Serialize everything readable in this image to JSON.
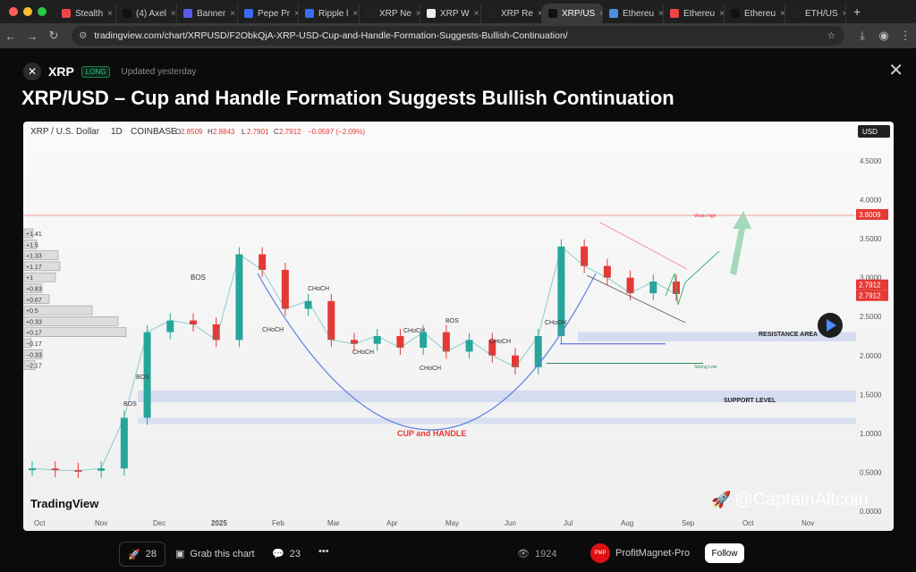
{
  "browser": {
    "tabs": [
      {
        "label": "Stealth",
        "color": "#e44"
      },
      {
        "label": "(4) Axel",
        "color": "#111"
      },
      {
        "label": "Banner",
        "color": "#5a5af0"
      },
      {
        "label": "Pepe Pr",
        "color": "#3b6cf0"
      },
      {
        "label": "Ripple l",
        "color": "#3b6cf0"
      },
      {
        "label": "XRP Ne",
        "color": "#222"
      },
      {
        "label": "XRP W",
        "color": "#eee"
      },
      {
        "label": "XRP Re",
        "color": "#222"
      },
      {
        "label": "XRP/US",
        "color": "#111",
        "active": true
      },
      {
        "label": "Ethereu",
        "color": "#4a90e2"
      },
      {
        "label": "Ethereu",
        "color": "#e44"
      },
      {
        "label": "Ethereu",
        "color": "#111"
      },
      {
        "label": "ETH/US",
        "color": "#222"
      }
    ],
    "new_tab": "+",
    "url": "tradingview.com/chart/XRPUSD/F2ObkQjA-XRP-USD-Cup-and-Handle-Formation-Suggests-Bullish-Continuation/"
  },
  "header": {
    "symbol": "XRP",
    "badge": "LONG",
    "updated": "Updated yesterday",
    "title": "XRP/USD – Cup and Handle Formation Suggests Bullish Continuation"
  },
  "chart_header": {
    "instrument": "XRP / U.S. Dollar",
    "interval": "1D",
    "exchange": "COINBASE",
    "o_label": "O",
    "o": "2.8509",
    "h_label": "H",
    "h": "2.8843",
    "l_label": "L",
    "l": "2.7901",
    "c_label": "C",
    "c": "2.7912",
    "change": "−0.0597 (−2.09%)",
    "currency": "USD"
  },
  "chart_data": {
    "type": "line",
    "title": "XRP/USD – Cup and Handle Formation Suggests Bullish Continuation",
    "x": [
      "Oct",
      "Nov",
      "Dec",
      "2025",
      "Feb",
      "Mar",
      "Apr",
      "May",
      "Jun",
      "Jul",
      "Aug",
      "Sep",
      "Oct",
      "Nov"
    ],
    "y_ticks": [
      "4.5000",
      "4.0000",
      "3.5000",
      "3.0000",
      "2.5000",
      "2.0000",
      "1.5000",
      "1.0000",
      "0.5000",
      "0.0000"
    ],
    "ylim": [
      0,
      4.5
    ],
    "series": [
      {
        "values": [
          0.55,
          0.53,
          0.52,
          0.55,
          1.2,
          2.3,
          2.45,
          2.4,
          2.2,
          3.3,
          3.1,
          2.6,
          2.7,
          2.2,
          2.15,
          2.25,
          2.1,
          2.3,
          2.05,
          2.2,
          2.0,
          1.85,
          2.25,
          3.4,
          3.15,
          3.0,
          2.8,
          2.95,
          2.79
        ]
      }
    ],
    "price_labels": [
      "3.8009",
      "2.7912",
      "2.7912"
    ],
    "annotations": [
      "BOS",
      "BOS",
      "BOS",
      "CHoCH",
      "CHoCH",
      "CHoCH",
      "CHoCH",
      "CHoCH",
      "CHoCH",
      "CHoCH",
      "BOS",
      "CUP and HANDLE",
      "RESISTANCE AREA",
      "SUPPORT LEVEL",
      "Weak High",
      "Strong Low"
    ],
    "volume_profile_labels": [
      "+1.41",
      "+1.5",
      "+1.33",
      "+1.17",
      "+1",
      "+0.83",
      "+0.67",
      "+0.5",
      "+0.33",
      "+0.17",
      "−0.17",
      "−0.33",
      "−2.17"
    ],
    "legend": "none",
    "grid": false
  },
  "branding": {
    "tradingview": "TradingView"
  },
  "footer": {
    "boosts": "28",
    "grab": "Grab this chart",
    "comments": "23",
    "more": "•••",
    "views": "1924",
    "author": "ProfitMagnet-Pro",
    "follow": "Follow",
    "watermark": "@CaptainAltcoin"
  },
  "colors": {
    "accent_red": "#e53935",
    "candle_green": "#26a69a",
    "cup_line": "#5b7fe0",
    "resistance": "#c7d2ee",
    "support": "#c7d2ee",
    "arrow_green": "#8fd1ad"
  }
}
